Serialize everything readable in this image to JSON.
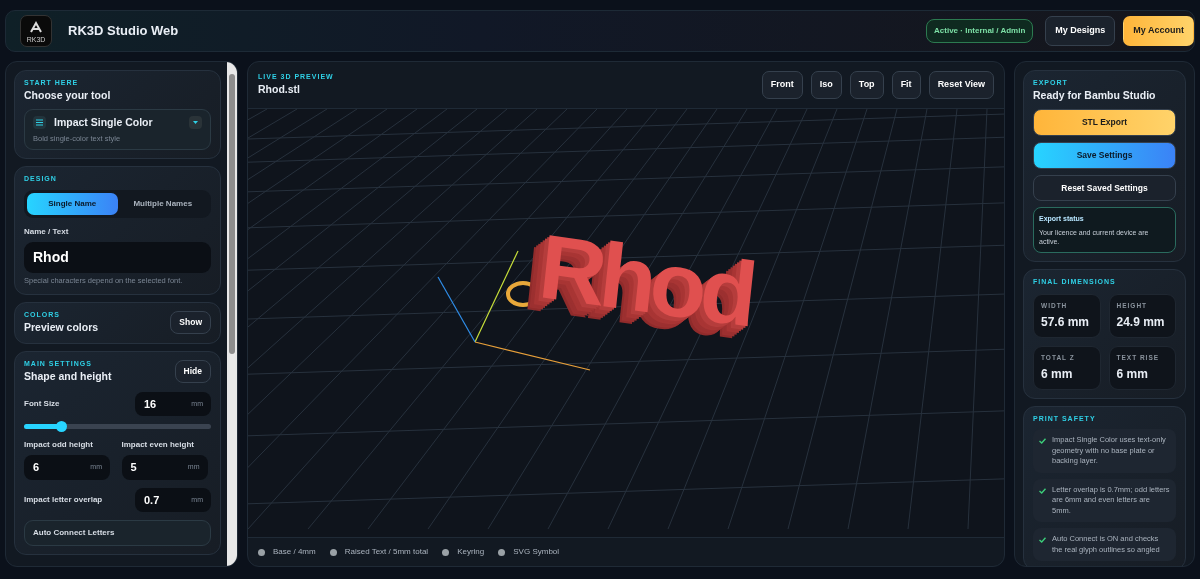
{
  "header": {
    "logo_text": "RK3D",
    "title": "RK3D Studio Web",
    "status_badge": "Active · Internal / Admin",
    "buttons": [
      {
        "label": "My Designs",
        "kind": "dark"
      },
      {
        "label": "My Account",
        "kind": "gold"
      }
    ]
  },
  "left_panel": {
    "tool_card": {
      "eyebrow": "START HERE",
      "title": "Choose your tool",
      "tool_name": "Impact Single Color",
      "tool_hint": "Bold single-color text style"
    },
    "design_card": {
      "eyebrow": "DESIGN",
      "tabs": [
        {
          "label": "Single Name",
          "selected": true
        },
        {
          "label": "Multiple Names",
          "selected": false
        }
      ],
      "field_label": "Name / Text",
      "field_value": "Rhod",
      "field_hint": "Special characters depend on the selected font."
    },
    "colors_card": {
      "eyebrow": "COLORS",
      "title": "Preview colors",
      "button": "Show"
    },
    "settings_card": {
      "eyebrow": "MAIN SETTINGS",
      "title": "Shape and height",
      "button": "Hide",
      "font_size": {
        "label": "Font Size",
        "value": "16",
        "unit": "mm",
        "level": 0.2
      },
      "odd": {
        "label": "Impact odd height",
        "value": "6",
        "unit": "mm"
      },
      "even": {
        "label": "Impact even height",
        "value": "5",
        "unit": "mm"
      },
      "overlap": {
        "label": "Impact letter overlap",
        "value": "0.7",
        "unit": "mm"
      },
      "next_row": "Auto Connect Letters"
    }
  },
  "preview": {
    "eyebrow": "LIVE 3D PREVIEW",
    "file": "Rhod.stl",
    "view_buttons": [
      "Front",
      "Iso",
      "Top",
      "Fit",
      "Reset View"
    ],
    "model_text": "Rhod",
    "legend": [
      "Base / 4mm",
      "Raised Text / 5mm total",
      "Keyring",
      "SVG Symbol"
    ]
  },
  "right_panel": {
    "export": {
      "eyebrow": "EXPORT",
      "title": "Ready for Bambu Studio",
      "buttons": [
        {
          "label": "STL Export",
          "kind": "gold"
        },
        {
          "label": "Save Settings",
          "kind": "blue"
        },
        {
          "label": "Reset Saved Settings",
          "kind": "dark"
        }
      ],
      "status_title": "Export status",
      "status_text": "Your licence and current device are active."
    },
    "dimensions": {
      "eyebrow": "FINAL DIMENSIONS",
      "items": [
        {
          "label": "WIDTH",
          "value": "57.6 mm"
        },
        {
          "label": "HEIGHT",
          "value": "24.9 mm"
        },
        {
          "label": "TOTAL Z",
          "value": "6 mm"
        },
        {
          "label": "TEXT RISE",
          "value": "6 mm"
        }
      ]
    },
    "safety": {
      "eyebrow": "PRINT SAFETY",
      "items": [
        "Impact Single Color uses text-only geometry with no base plate or backing layer.",
        "Letter overlap is 0.7mm; odd letters are 6mm and even letters are 5mm.",
        "Auto Connect is ON and checks the real glyph outlines so angled"
      ]
    }
  }
}
